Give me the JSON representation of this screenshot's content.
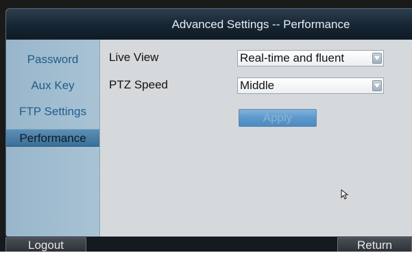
{
  "window": {
    "title": "Advanced Settings -- Performance"
  },
  "sidebar": {
    "items": [
      {
        "label": "Password",
        "active": false
      },
      {
        "label": "Aux Key",
        "active": false
      },
      {
        "label": "FTP Settings",
        "active": false
      },
      {
        "label": "Performance",
        "active": true
      }
    ]
  },
  "form": {
    "live_view": {
      "label": "Live View",
      "value": "Real-time and fluent"
    },
    "ptz_speed": {
      "label": "PTZ Speed",
      "value": "Middle"
    },
    "apply_label": "Apply"
  },
  "footer": {
    "logout_label": "Logout",
    "return_label": "Return"
  },
  "icons": {
    "dropdown": "chevron-down-icon",
    "cursor": "mouse-cursor-icon"
  },
  "colors": {
    "accent": "#1f5d8c",
    "active_item": "#3a6f98",
    "apply_button": "#5b98cc"
  }
}
